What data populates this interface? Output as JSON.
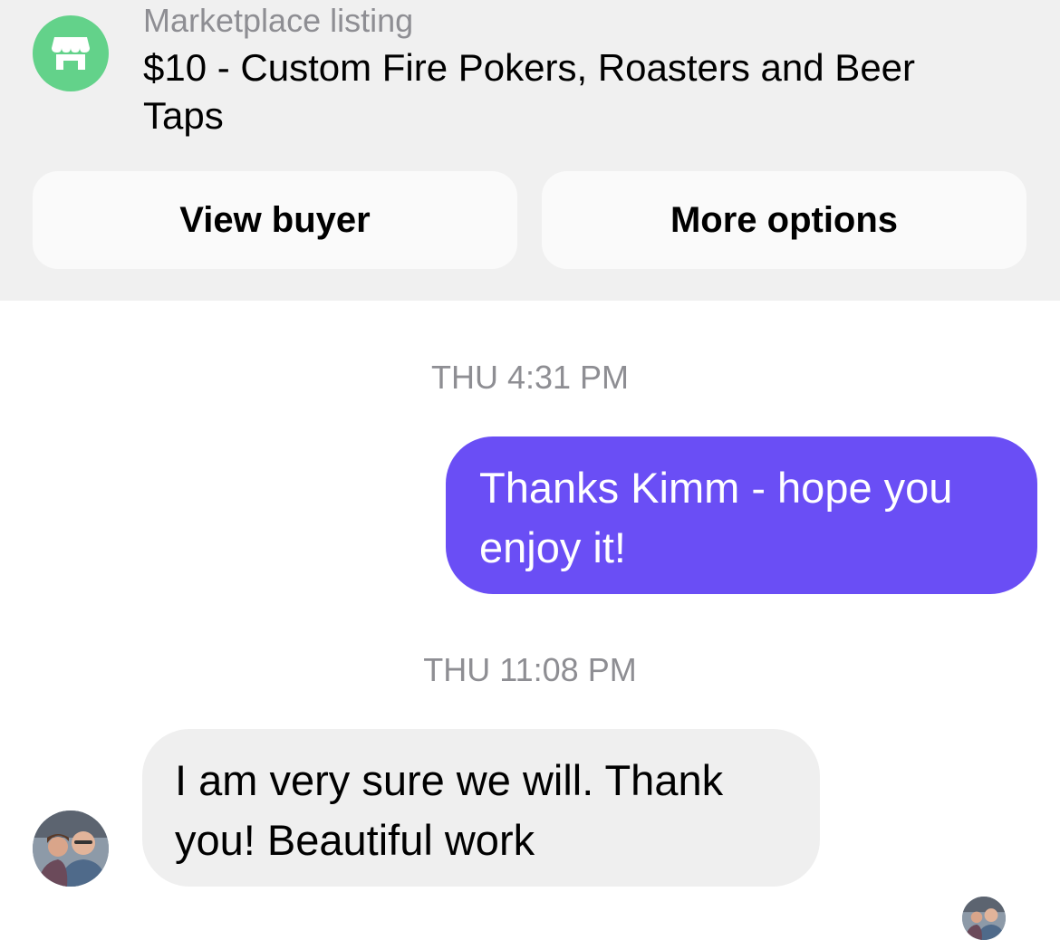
{
  "listing": {
    "label": "Marketplace listing",
    "title": "$10 - Custom Fire Pokers, Roasters and Beer Taps",
    "icon": "marketplace-store-icon",
    "icon_color": "#63d28a"
  },
  "actions": {
    "view_buyer": "View buyer",
    "more_options": "More options"
  },
  "messages": [
    {
      "timestamp": "THU 4:31 PM",
      "direction": "outgoing",
      "text": "Thanks Kimm - hope you enjoy it!",
      "bubble_color": "#6a4ef5"
    },
    {
      "timestamp": "THU 11:08 PM",
      "direction": "incoming",
      "text": "I am very sure we will.  Thank you! Beautiful work",
      "bubble_color": "#efefef"
    }
  ],
  "colors": {
    "header_background": "#f0f0f0",
    "secondary_text": "#8e8e93"
  }
}
